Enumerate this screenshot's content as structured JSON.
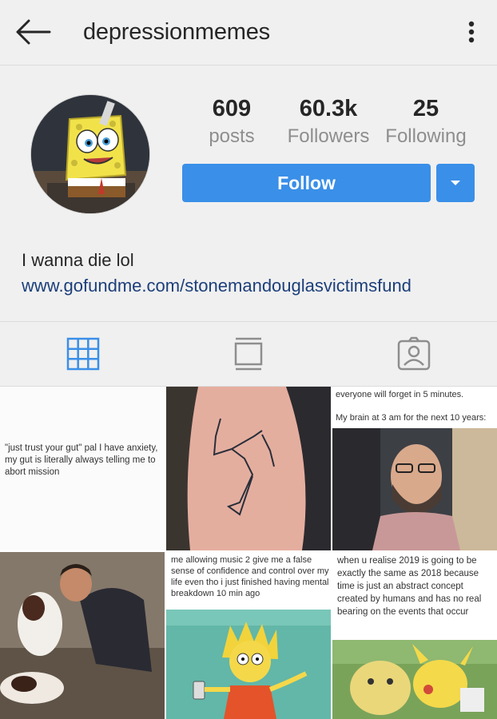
{
  "header": {
    "username": "depressionmemes",
    "back_icon": "arrow-left-icon",
    "more_icon": "more-vertical-icon"
  },
  "profile": {
    "posts_count": "609",
    "posts_label": "posts",
    "followers_count": "60.3k",
    "followers_label": "Followers",
    "following_count": "25",
    "following_label": "Following",
    "follow_label": "Follow",
    "bio": "I wanna die lol",
    "website": "www.gofundme.com/stonemandouglasvictimsfund"
  },
  "tabs": [
    {
      "name": "grid",
      "icon": "grid-icon",
      "active": true
    },
    {
      "name": "feed",
      "icon": "feed-icon",
      "active": false
    },
    {
      "name": "tagged",
      "icon": "tagged-person-icon",
      "active": false
    }
  ],
  "posts": {
    "p1_text": "\"just trust your gut\" pal I have anxiety, my gut is literally always telling me to abort mission",
    "p3_line1": "everyone will forget in 5 minutes.",
    "p3_line2": "My brain at 3 am for the next 10 years:",
    "p5_text": "me allowing music 2 give me a false sense of confidence and control over my life even tho i just finished having mental breakdown 10 min ago",
    "p6_text": "when u realise 2019 is going to be exactly the same as 2018 because time is just an abstract concept created by humans and has no real bearing on the events that occur"
  },
  "colors": {
    "accent": "#3a8fe8",
    "link": "#1c3f7a",
    "background": "#f0f0f0",
    "muted": "#8e8e8e"
  }
}
